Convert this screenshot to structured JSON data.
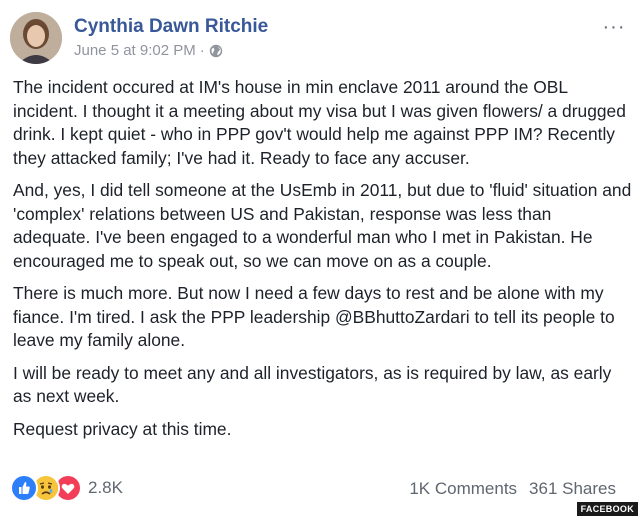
{
  "post": {
    "author": "Cynthia Dawn Ritchie",
    "timestamp": "June 5 at 9:02 PM",
    "privacy_separator": "·",
    "privacy_icon": "globe-icon",
    "more_icon": "ellipsis-icon",
    "more_label": "···",
    "paragraphs": [
      "The incident occured at IM's house in min enclave 2011 around the OBL incident. I thought it a meeting about my visa but I was given flowers/ a drugged drink. I kept quiet - who in PPP gov't would help me against PPP IM? Recently they attacked family; I've had it. Ready to face any accuser.",
      "And, yes, I did tell someone at the UsEmb in 2011, but due to 'fluid' situation and 'complex' relations between US and Pakistan, response was less than adequate. I've been engaged to a wonderful man who I met in Pakistan. He encouraged me to speak out, so we can move on as a couple.",
      "There is much more. But now I need a few days to rest and be alone with my fiance. I'm tired. I ask the PPP leadership @BBhuttoZardari to tell its people to leave my family alone.",
      "I will be ready to meet any and all investigators, as is required by law, as early as next week.",
      "Request privacy at this time."
    ]
  },
  "engagement": {
    "reactions": [
      "like-icon",
      "sad-icon",
      "love-icon"
    ],
    "reaction_count": "2.8K",
    "comments": "1K Comments",
    "shares": "361 Shares"
  },
  "watermark": "FACEBOOK",
  "colors": {
    "author": "#385898",
    "meta": "#90949c",
    "like": "#2d7ff9",
    "sad": "#f7c53c",
    "love": "#f33e58"
  }
}
